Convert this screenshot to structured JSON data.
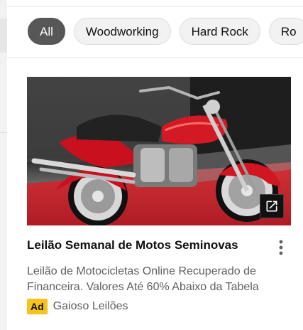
{
  "chips": [
    {
      "label": "All",
      "active": true
    },
    {
      "label": "Woodworking",
      "active": false
    },
    {
      "label": "Hard Rock",
      "active": false
    },
    {
      "label": "Ro",
      "active": false
    }
  ],
  "ad_card": {
    "thumbnail_alt": "red motorcycle",
    "title": "Leilão Semanal de Motos Seminovas",
    "description": "Leilão de Motocicletas Online Recuperado de Financeira. Valores Até 60% Abaixo da Tabela",
    "badge": "Ad",
    "advertiser": "Gaioso Leilões",
    "icons": {
      "open": "open-in-new-icon",
      "more": "more-vert-icon"
    }
  },
  "colors": {
    "chip_active_bg": "#575757",
    "chip_bg": "#f2f2f2",
    "ad_badge": "#f7c31a",
    "text_primary": "#0f0f0f",
    "text_secondary": "#606060"
  }
}
